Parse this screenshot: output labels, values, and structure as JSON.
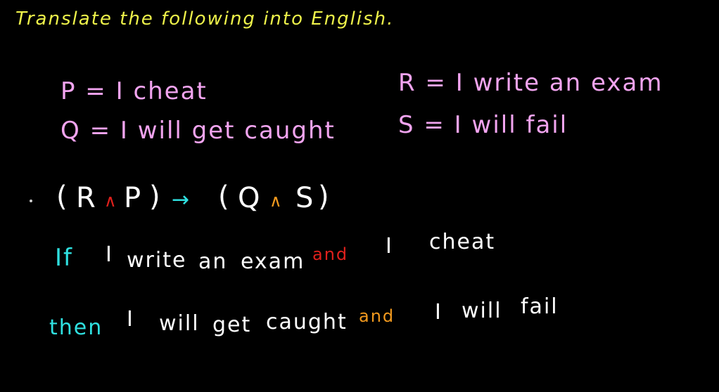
{
  "title": "Translate the following into English.",
  "definitions": {
    "p": "P = I cheat",
    "q": "Q = I will get caught",
    "r": "R = I write an exam",
    "s": "S = I will fail"
  },
  "formula": {
    "open_paren_1": "(",
    "r": "R",
    "and_1": "∧",
    "p": "P",
    "close_paren_1": ")",
    "arrow": "→",
    "open_paren_2": "(",
    "q": "Q",
    "and_2": "∧",
    "s": "S",
    "close_paren_2": ")"
  },
  "translation": {
    "line1": {
      "if": "If",
      "i": "I",
      "write": "write",
      "an": "an",
      "exam": "exam",
      "and": "and",
      "i2": "I",
      "cheat": "cheat"
    },
    "line2": {
      "then": "then",
      "i": "I",
      "will": "will",
      "get": "get",
      "caught": "caught",
      "and": "and",
      "i2": "I",
      "will2": "will",
      "fail": "fail"
    }
  },
  "colors": {
    "background": "#000000",
    "title": "#eef24a",
    "definitions": "#f2a4f0",
    "connective_and_red": "#e0201c",
    "connective_and_orange": "#f39a1e",
    "connective_if_then": "#2fe0e0",
    "text": "#ffffff"
  }
}
